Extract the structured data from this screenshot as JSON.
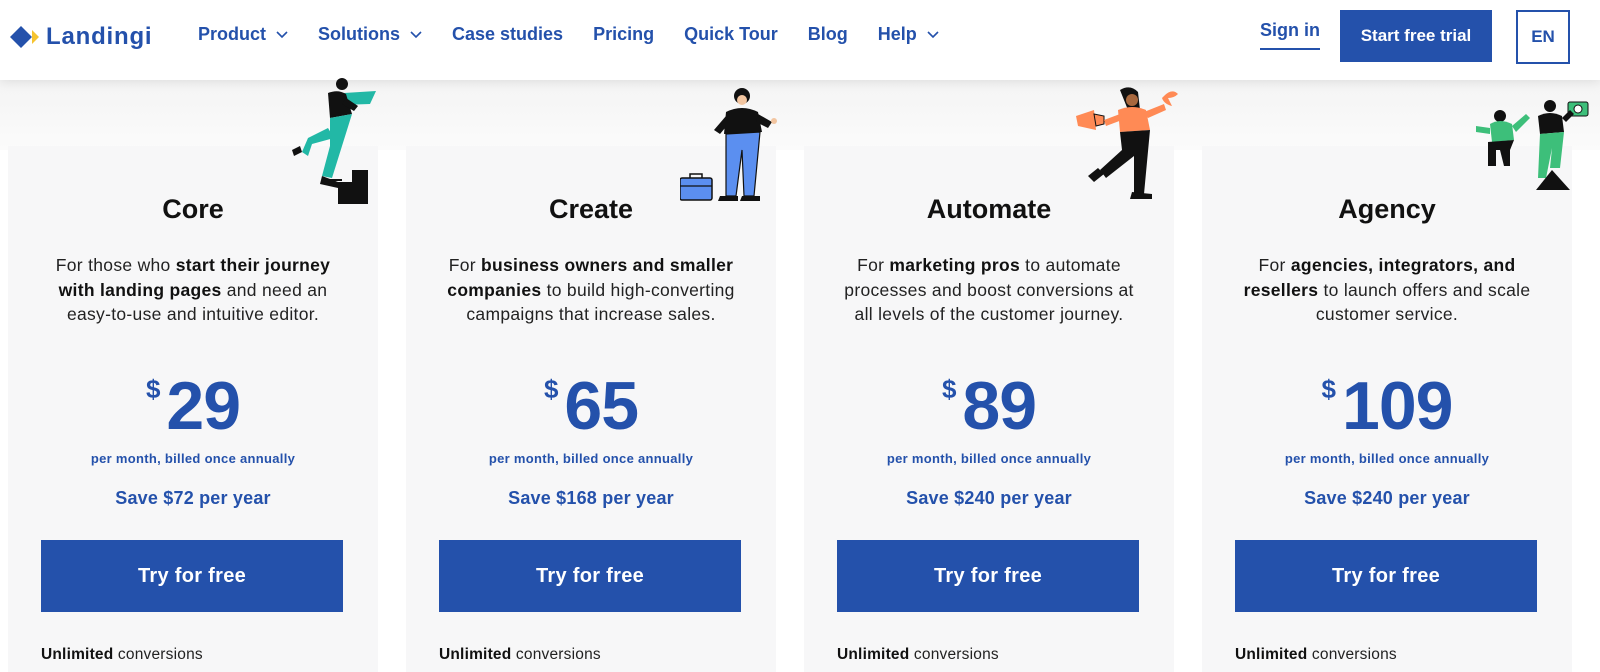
{
  "header": {
    "logo_text": "Landingi",
    "nav": [
      {
        "label": "Product",
        "has_dropdown": true
      },
      {
        "label": "Solutions",
        "has_dropdown": true
      },
      {
        "label": "Case studies",
        "has_dropdown": false
      },
      {
        "label": "Pricing",
        "has_dropdown": false
      },
      {
        "label": "Quick Tour",
        "has_dropdown": false
      },
      {
        "label": "Blog",
        "has_dropdown": false
      },
      {
        "label": "Help",
        "has_dropdown": true
      }
    ],
    "sign_in": "Sign in",
    "start_trial": "Start free trial",
    "language": "EN"
  },
  "colors": {
    "brand_blue": "#2451ab",
    "logo_yellow": "#f6c431",
    "card_bg": "#f7f7f8",
    "teal": "#22b8a6",
    "blue_pants": "#5b8ff0",
    "orange": "#ff8a55",
    "green": "#3dbf7a"
  },
  "plans": [
    {
      "name": "Core",
      "desc": [
        {
          "t": "For those who ",
          "b": false
        },
        {
          "t": "start their journey with landing pages",
          "b": true
        },
        {
          "t": " and need an easy-to-use and intuitive editor.",
          "b": false
        }
      ],
      "currency": "$",
      "price": "29",
      "period": "per month, billed once annually",
      "save": "Save $72 per year",
      "cta": "Try for free",
      "feature_bold": "Unlimited",
      "feature_rest": " conversions",
      "illustration": "person-climbing-steps-icon"
    },
    {
      "name": "Create",
      "desc": [
        {
          "t": "For ",
          "b": false
        },
        {
          "t": "business owners and smaller companies",
          "b": true
        },
        {
          "t": " to build high-converting campaigns that increase sales.",
          "b": false
        }
      ],
      "currency": "$",
      "price": "65",
      "period": "per month, billed once annually",
      "save": "Save $168 per year",
      "cta": "Try for free",
      "feature_bold": "Unlimited",
      "feature_rest": " conversions",
      "illustration": "person-with-briefcase-icon"
    },
    {
      "name": "Automate",
      "desc": [
        {
          "t": "For ",
          "b": false
        },
        {
          "t": "marketing pros",
          "b": true
        },
        {
          "t": " to automate processes and boost conversions at all levels of the customer journey.",
          "b": false
        }
      ],
      "currency": "$",
      "price": "89",
      "period": "per month, billed once annually",
      "save": "Save $240 per year",
      "cta": "Try for free",
      "feature_bold": "Unlimited",
      "feature_rest": " conversions",
      "illustration": "person-with-megaphone-icon"
    },
    {
      "name": "Agency",
      "desc": [
        {
          "t": "For ",
          "b": false
        },
        {
          "t": "agencies, integrators, and resellers",
          "b": true
        },
        {
          "t": " to launch offers and scale customer service.",
          "b": false
        }
      ],
      "currency": "$",
      "price": "109",
      "period": "per month, billed once annually",
      "save": "Save $240 per year",
      "cta": "Try for free",
      "feature_bold": "Unlimited",
      "feature_rest": " conversions",
      "illustration": "team-people-icon"
    }
  ]
}
